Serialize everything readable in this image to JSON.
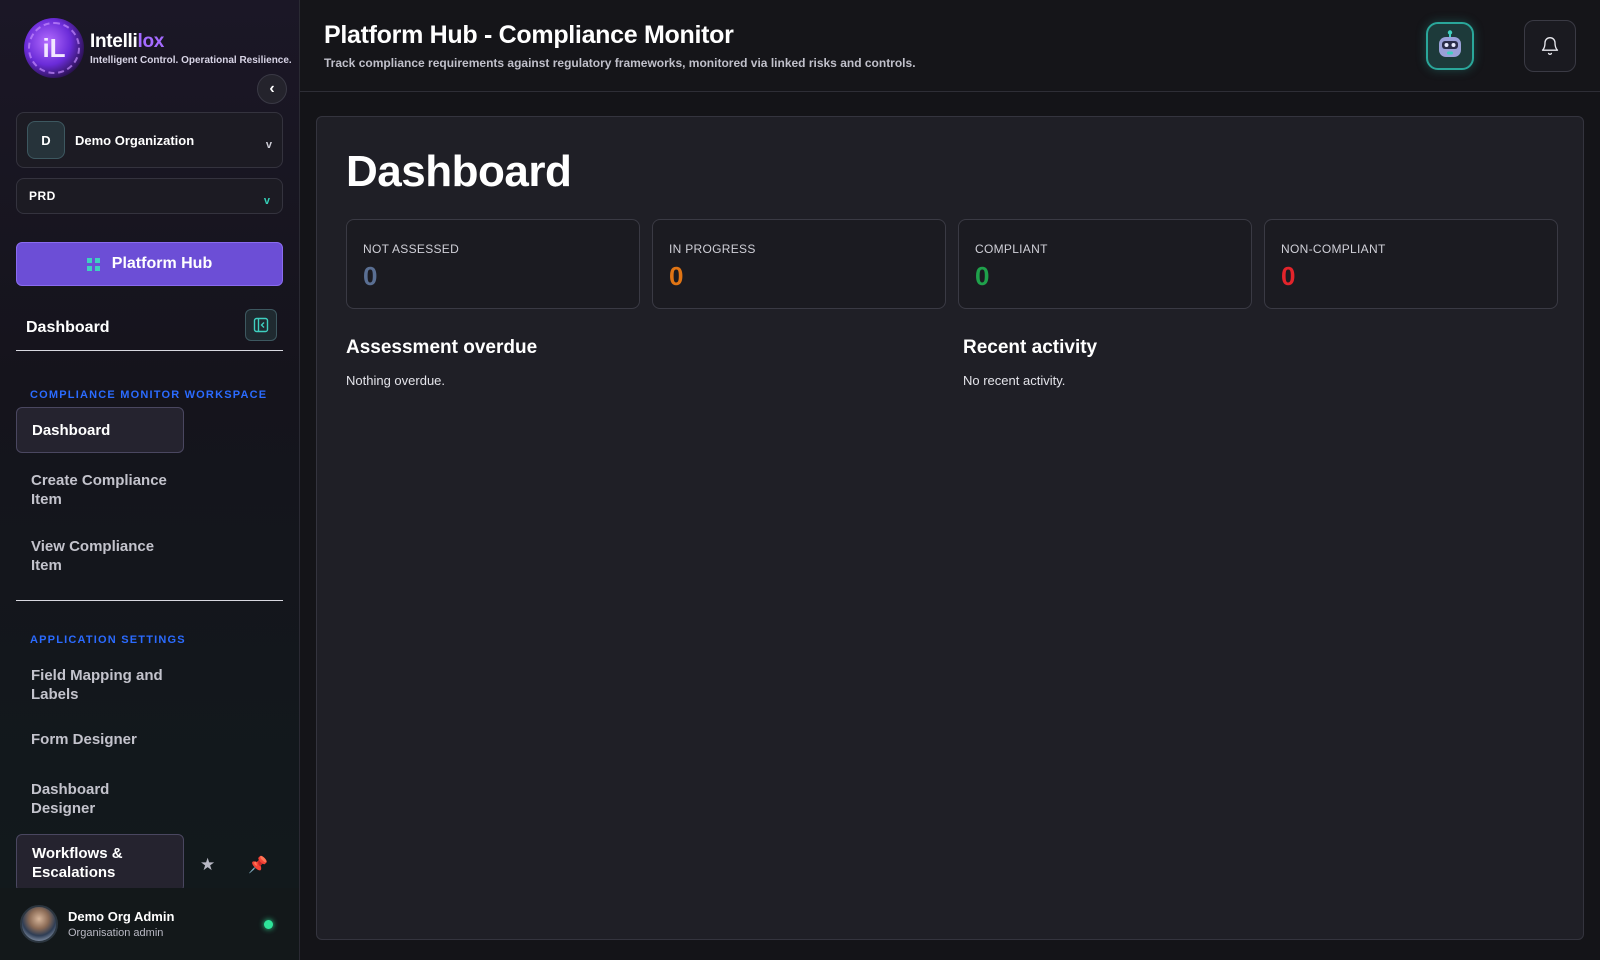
{
  "brand": {
    "logo_letters": "iL",
    "name_part1": "Intelli",
    "name_part2": "lox",
    "tagline": "Intelligent Control. Operational Resilience."
  },
  "sidebar": {
    "collapse_glyph": "‹",
    "org": {
      "initial": "D",
      "name": "Demo Organization",
      "chevron": "v"
    },
    "env": {
      "name": "PRD",
      "chevron": "v"
    },
    "hub_button_label": "Platform Hub",
    "dashboard_label": "Dashboard",
    "workspace_section": "COMPLIANCE MONITOR WORKSPACE",
    "workspace_items": [
      {
        "label": "Dashboard",
        "active": true
      },
      {
        "label": "Create Compliance Item",
        "active": false
      },
      {
        "label": "View Compliance Item",
        "active": false
      }
    ],
    "settings_section": "APPLICATION SETTINGS",
    "settings_items": [
      {
        "label": "Field Mapping and Labels"
      },
      {
        "label": "Form Designer"
      },
      {
        "label": "Dashboard Designer"
      },
      {
        "label": "Workflows & Escalations",
        "active": true
      }
    ],
    "user": {
      "name": "Demo Org Admin",
      "role": "Organisation admin",
      "status_color": "#2ee59a"
    }
  },
  "header": {
    "title": "Platform Hub - Compliance Monitor",
    "subtitle": "Track compliance requirements against regulatory frameworks, monitored via linked risks and controls."
  },
  "main": {
    "title": "Dashboard",
    "stats": [
      {
        "label": "NOT ASSESSED",
        "value": "0",
        "color": "#5a6f93"
      },
      {
        "label": "IN PROGRESS",
        "value": "0",
        "color": "#e07414"
      },
      {
        "label": "COMPLIANT",
        "value": "0",
        "color": "#1fa14b"
      },
      {
        "label": "NON-COMPLIANT",
        "value": "0",
        "color": "#e3242b"
      }
    ],
    "overdue": {
      "title": "Assessment overdue",
      "body": "Nothing overdue."
    },
    "activity": {
      "title": "Recent activity",
      "body": "No recent activity."
    }
  },
  "icons": {
    "star": "★",
    "pin": "📌",
    "bot": "robot-icon",
    "bell": "bell-icon"
  }
}
